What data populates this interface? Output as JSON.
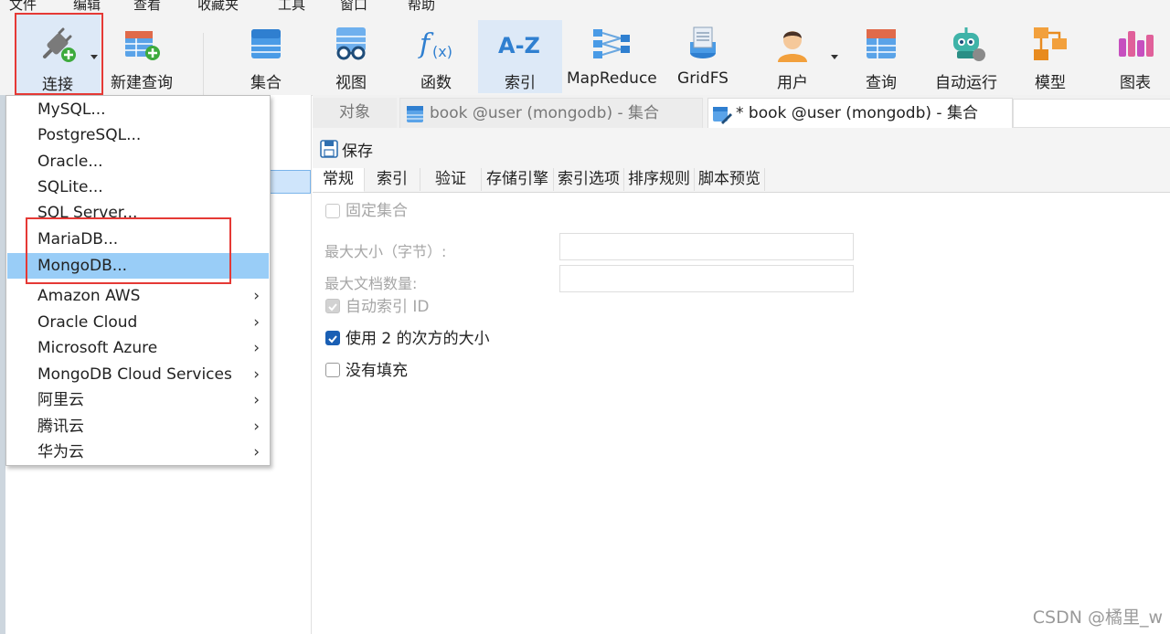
{
  "menubar": {
    "items": [
      "文件",
      "编辑",
      "查看",
      "收藏夹",
      "工具",
      "窗口",
      "帮助"
    ]
  },
  "toolbar": {
    "buttons": [
      {
        "label": "连接",
        "icon": "plug-add-icon"
      },
      {
        "label": "新建查询",
        "icon": "new-query-icon"
      },
      {
        "label": "集合",
        "icon": "collection-icon"
      },
      {
        "label": "视图",
        "icon": "view-glasses-icon"
      },
      {
        "label": "函数",
        "icon": "function-icon"
      },
      {
        "label": "索引",
        "icon": "index-az-icon"
      },
      {
        "label": "MapReduce",
        "icon": "mapreduce-icon"
      },
      {
        "label": "GridFS",
        "icon": "gridfs-icon"
      },
      {
        "label": "用户",
        "icon": "user-icon"
      },
      {
        "label": "查询",
        "icon": "query-icon"
      },
      {
        "label": "自动运行",
        "icon": "robot-icon"
      },
      {
        "label": "模型",
        "icon": "model-icon"
      },
      {
        "label": "图表",
        "icon": "chart-icon"
      }
    ]
  },
  "tabs": {
    "object": "对象",
    "book_tab_1": "book @user (mongodb) - 集合",
    "book_tab_2": "* book @user (mongodb) - 集合"
  },
  "savebar": {
    "save_label": "保存"
  },
  "subtabs": [
    "常规",
    "索引",
    "验证",
    "存储引擎",
    "索引选项",
    "排序规则",
    "脚本预览"
  ],
  "form": {
    "capped": "固定集合",
    "max_size": "最大大小（字节）:",
    "max_docs": "最大文档数量:",
    "auto_index_id": "自动索引 ID",
    "power_of_2": "使用 2 的次方的大小",
    "no_padding": "没有填充"
  },
  "connect_menu": {
    "items": [
      {
        "label": "MySQL...",
        "submenu": false
      },
      {
        "label": "PostgreSQL...",
        "submenu": false
      },
      {
        "label": "Oracle...",
        "submenu": false
      },
      {
        "label": "SQLite...",
        "submenu": false
      },
      {
        "label": "SQL Server...",
        "submenu": false
      },
      {
        "label": "MariaDB...",
        "submenu": false
      },
      {
        "label": "MongoDB...",
        "submenu": false,
        "highlighted": true
      },
      {
        "label": "Amazon AWS",
        "submenu": true
      },
      {
        "label": "Oracle Cloud",
        "submenu": true
      },
      {
        "label": "Microsoft Azure",
        "submenu": true
      },
      {
        "label": "MongoDB Cloud Services",
        "submenu": true
      },
      {
        "label": "阿里云",
        "submenu": true
      },
      {
        "label": "腾讯云",
        "submenu": true
      },
      {
        "label": "华为云",
        "submenu": true
      }
    ],
    "submenu_arrow": "›"
  },
  "watermark": "CSDN @橘里_w",
  "colors": {
    "highlight": "#99cdf7",
    "annotation_red": "#e53935",
    "checkbox_checked": "#1a5fb4"
  }
}
